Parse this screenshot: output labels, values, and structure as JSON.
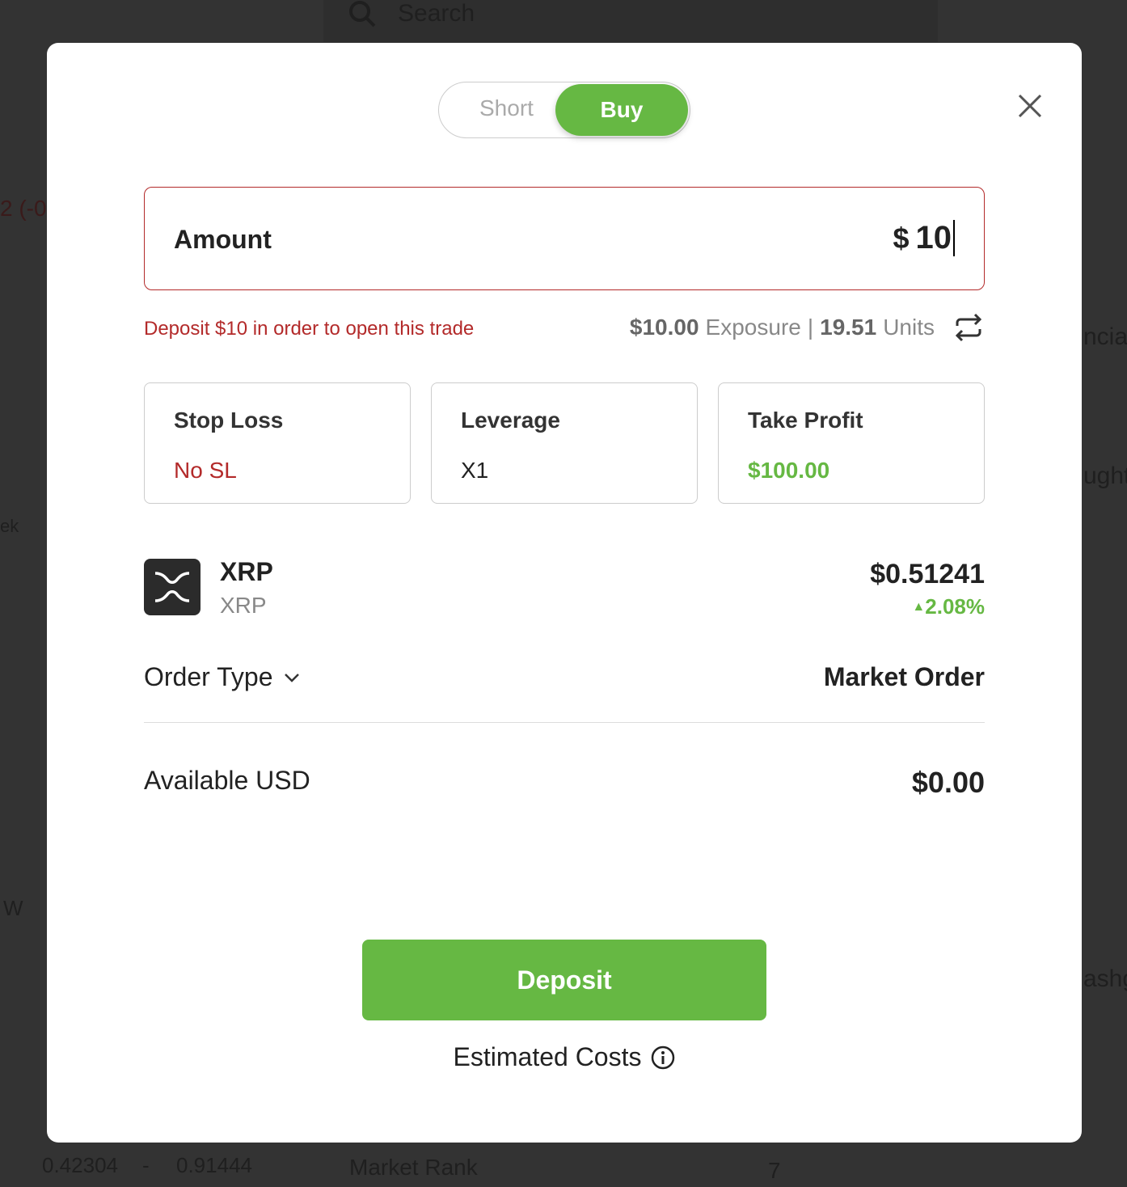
{
  "background": {
    "search_placeholder": "Search",
    "change_fragment": "2 (-0.",
    "week_fragment": "ek",
    "w_fragment": "W",
    "range_low": "0.42304",
    "range_sep": "-",
    "range_high": "0.91444",
    "market_rank_label": "Market Rank",
    "market_rank_value": "7",
    "frag1": "ncia",
    "frag2": "ught",
    "frag3": "ashg"
  },
  "toggle": {
    "short": "Short",
    "buy": "Buy",
    "selected": "Buy"
  },
  "amount": {
    "label": "Amount",
    "currency": "$",
    "value": "10"
  },
  "warning": "Deposit $10 in order to open this trade",
  "exposure": {
    "value": "$10.00",
    "label": "Exposure",
    "sep": "|",
    "units": "19.51",
    "units_label": "Units"
  },
  "cards": [
    {
      "title": "Stop Loss",
      "value": "No SL"
    },
    {
      "title": "Leverage",
      "value": "X1"
    },
    {
      "title": "Take Profit",
      "value": "$100.00"
    }
  ],
  "asset": {
    "name": "XRP",
    "symbol": "XRP",
    "price": "$0.51241",
    "change": "2.08%"
  },
  "order_type": {
    "label": "Order Type",
    "value": "Market Order"
  },
  "available": {
    "label": "Available USD",
    "value": "$0.00"
  },
  "deposit_button": "Deposit",
  "estimated_costs": "Estimated Costs",
  "colors": {
    "accent": "#66b843",
    "error": "#b32a2a",
    "overlay": "#333333"
  }
}
